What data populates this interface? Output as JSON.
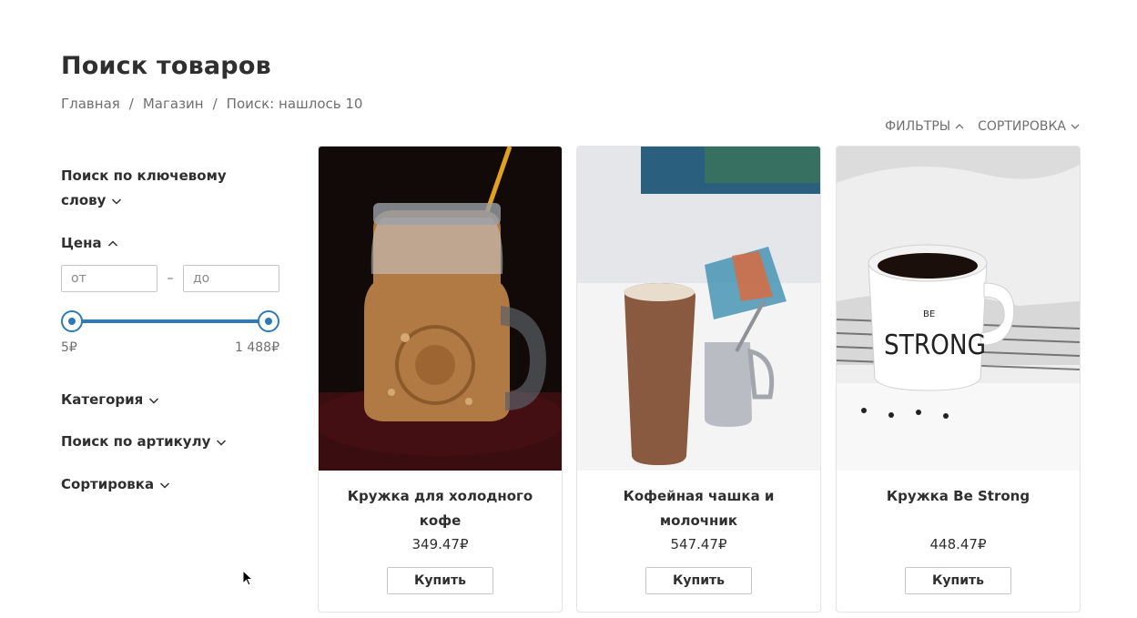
{
  "header": {
    "title": "Поиск товаров",
    "breadcrumb": [
      "Главная",
      "Магазин",
      "Поиск: нашлось 10"
    ],
    "breadcrumb_sep": "/"
  },
  "toolbar": {
    "filters_label": "ФИЛЬТРЫ",
    "filters_icon": "chevron-up-icon",
    "sort_label": "СОРТИРОВКА",
    "sort_icon": "chevron-down-icon"
  },
  "sidebar": {
    "keyword_label": "Поиск по ключевому слову",
    "price_label": "Цена",
    "price_from_placeholder": "от",
    "price_to_placeholder": "до",
    "price_dash": "–",
    "price_min": "5₽",
    "price_max": "1 488₽",
    "category_label": "Категория",
    "sku_label": "Поиск по артикулу",
    "sort_label": "Сортировка"
  },
  "colors": {
    "accent": "#2d7ab8",
    "text": "#2f2f2f",
    "muted": "#6f6f6f",
    "border": "#e4e4e4"
  },
  "products": [
    {
      "name": "Кружка для холодного кофе",
      "price": "349.47₽",
      "buy_label": "Купить"
    },
    {
      "name": "Кофейная чашка и молочник",
      "price": "547.47₽",
      "buy_label": "Купить"
    },
    {
      "name": "Кружка Be Strong",
      "price": "448.47₽",
      "buy_label": "Купить",
      "mug_text_small": "BE",
      "mug_text_large": "STRONG"
    }
  ]
}
